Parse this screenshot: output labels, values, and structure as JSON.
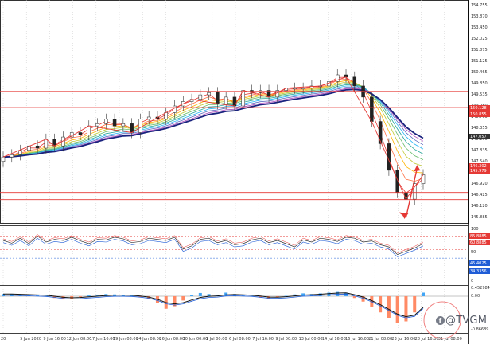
{
  "chart": {
    "price_scale": [
      "154.755",
      "153.870",
      "153.450",
      "152.025",
      "151.875",
      "151.125",
      "150.465",
      "149.850",
      "149.535",
      "149.280",
      "148.705",
      "148.355",
      "148.150",
      "147.835",
      "147.540",
      "147.225",
      "146.920",
      "146.425",
      "146.120",
      "145.885"
    ],
    "price_tags": [
      {
        "label": "150.128",
        "color": "#e53935"
      },
      {
        "label": "150.855",
        "color": "#e53935"
      },
      {
        "label": "147.057",
        "color": "#333333"
      },
      {
        "label": "146.302",
        "color": "#e53935"
      },
      {
        "label": "145.979",
        "color": "#e53935"
      }
    ],
    "osc_scale": [
      "100",
      "85.8885",
      "60.8885",
      "50",
      "45.4025",
      "34.3356",
      "0"
    ],
    "osc_tags": [
      {
        "label": "85.8885",
        "color": "#e53935"
      },
      {
        "label": "60.8885",
        "color": "#e53935"
      },
      {
        "label": "45.4025",
        "color": "#1f5cd6"
      },
      {
        "label": "34.3356",
        "color": "#1f5cd6"
      }
    ],
    "macd_scale": [
      "0.452984",
      "0.00",
      "-0.86689"
    ],
    "time_labels": [
      "20",
      "5 Jun 2020",
      "9 Jun 16:00",
      "12 Jun 08:00",
      "17 Jun 16:00",
      "19 Jun 08:00",
      "24 Jun 08:00",
      "26 Jun 08:00",
      "30 Jun 00:00",
      "1 Jul 00:00",
      "6 Jul 08:00",
      "7 Jul 16:00",
      "9 Jul 00:00",
      "13 Jul 00:00",
      "14 Jul 16:00",
      "16 Jul 16:00",
      "21 Jul 08:00",
      "23 Jul 16:00",
      "28 Jul 16:00",
      "31 Jul 08:00"
    ],
    "watermark": "@TVGM",
    "watermark_icon": "f"
  },
  "chart_data": {
    "type": "line",
    "x": "time",
    "price_close_approx": [
      147.9,
      148.0,
      148.2,
      148.4,
      148.3,
      148.7,
      148.4,
      148.8,
      149.0,
      148.9,
      149.3,
      149.4,
      149.6,
      149.3,
      149.4,
      149.0,
      149.6,
      149.7,
      149.6,
      149.9,
      150.2,
      150.4,
      150.5,
      150.7,
      150.8,
      150.3,
      150.6,
      150.2,
      150.9,
      150.8,
      150.9,
      150.6,
      150.9,
      151.0,
      151.0,
      151.0,
      151.1,
      151.1,
      151.3,
      151.6,
      151.5,
      151.1,
      150.6,
      149.5,
      148.5,
      147.3,
      146.3,
      146.0,
      146.7,
      147.1
    ],
    "oscillator_approx": [
      78,
      73,
      82,
      72,
      86,
      75,
      80,
      78,
      84,
      77,
      72,
      80,
      79,
      84,
      81,
      74,
      76,
      82,
      80,
      78,
      84,
      62,
      68,
      80,
      82,
      74,
      78,
      70,
      72,
      79,
      82,
      74,
      78,
      72,
      66,
      79,
      75,
      82,
      80,
      76,
      84,
      82,
      75,
      77,
      70,
      66,
      52,
      58,
      64,
      72
    ],
    "histogram_approx": [
      0.06,
      0.06,
      0.04,
      0.03,
      0.02,
      0.01,
      -0.05,
      -0.09,
      -0.07,
      -0.02,
      0.02,
      0.03,
      0.06,
      0.05,
      0.03,
      0.02,
      -0.03,
      -0.08,
      -0.2,
      -0.35,
      -0.28,
      -0.12,
      0.04,
      0.09,
      0.06,
      0.03,
      0.1,
      0.06,
      0.02,
      0.01,
      -0.04,
      -0.08,
      -0.03,
      0.01,
      0.05,
      0.08,
      0.06,
      0.08,
      0.1,
      0.12,
      0.1,
      -0.05,
      -0.15,
      -0.3,
      -0.45,
      -0.6,
      -0.75,
      -0.7,
      -0.45,
      0.1
    ],
    "horizontal_levels": [
      150.128,
      150.855,
      146.302,
      145.979
    ],
    "last_price": 147.057
  }
}
